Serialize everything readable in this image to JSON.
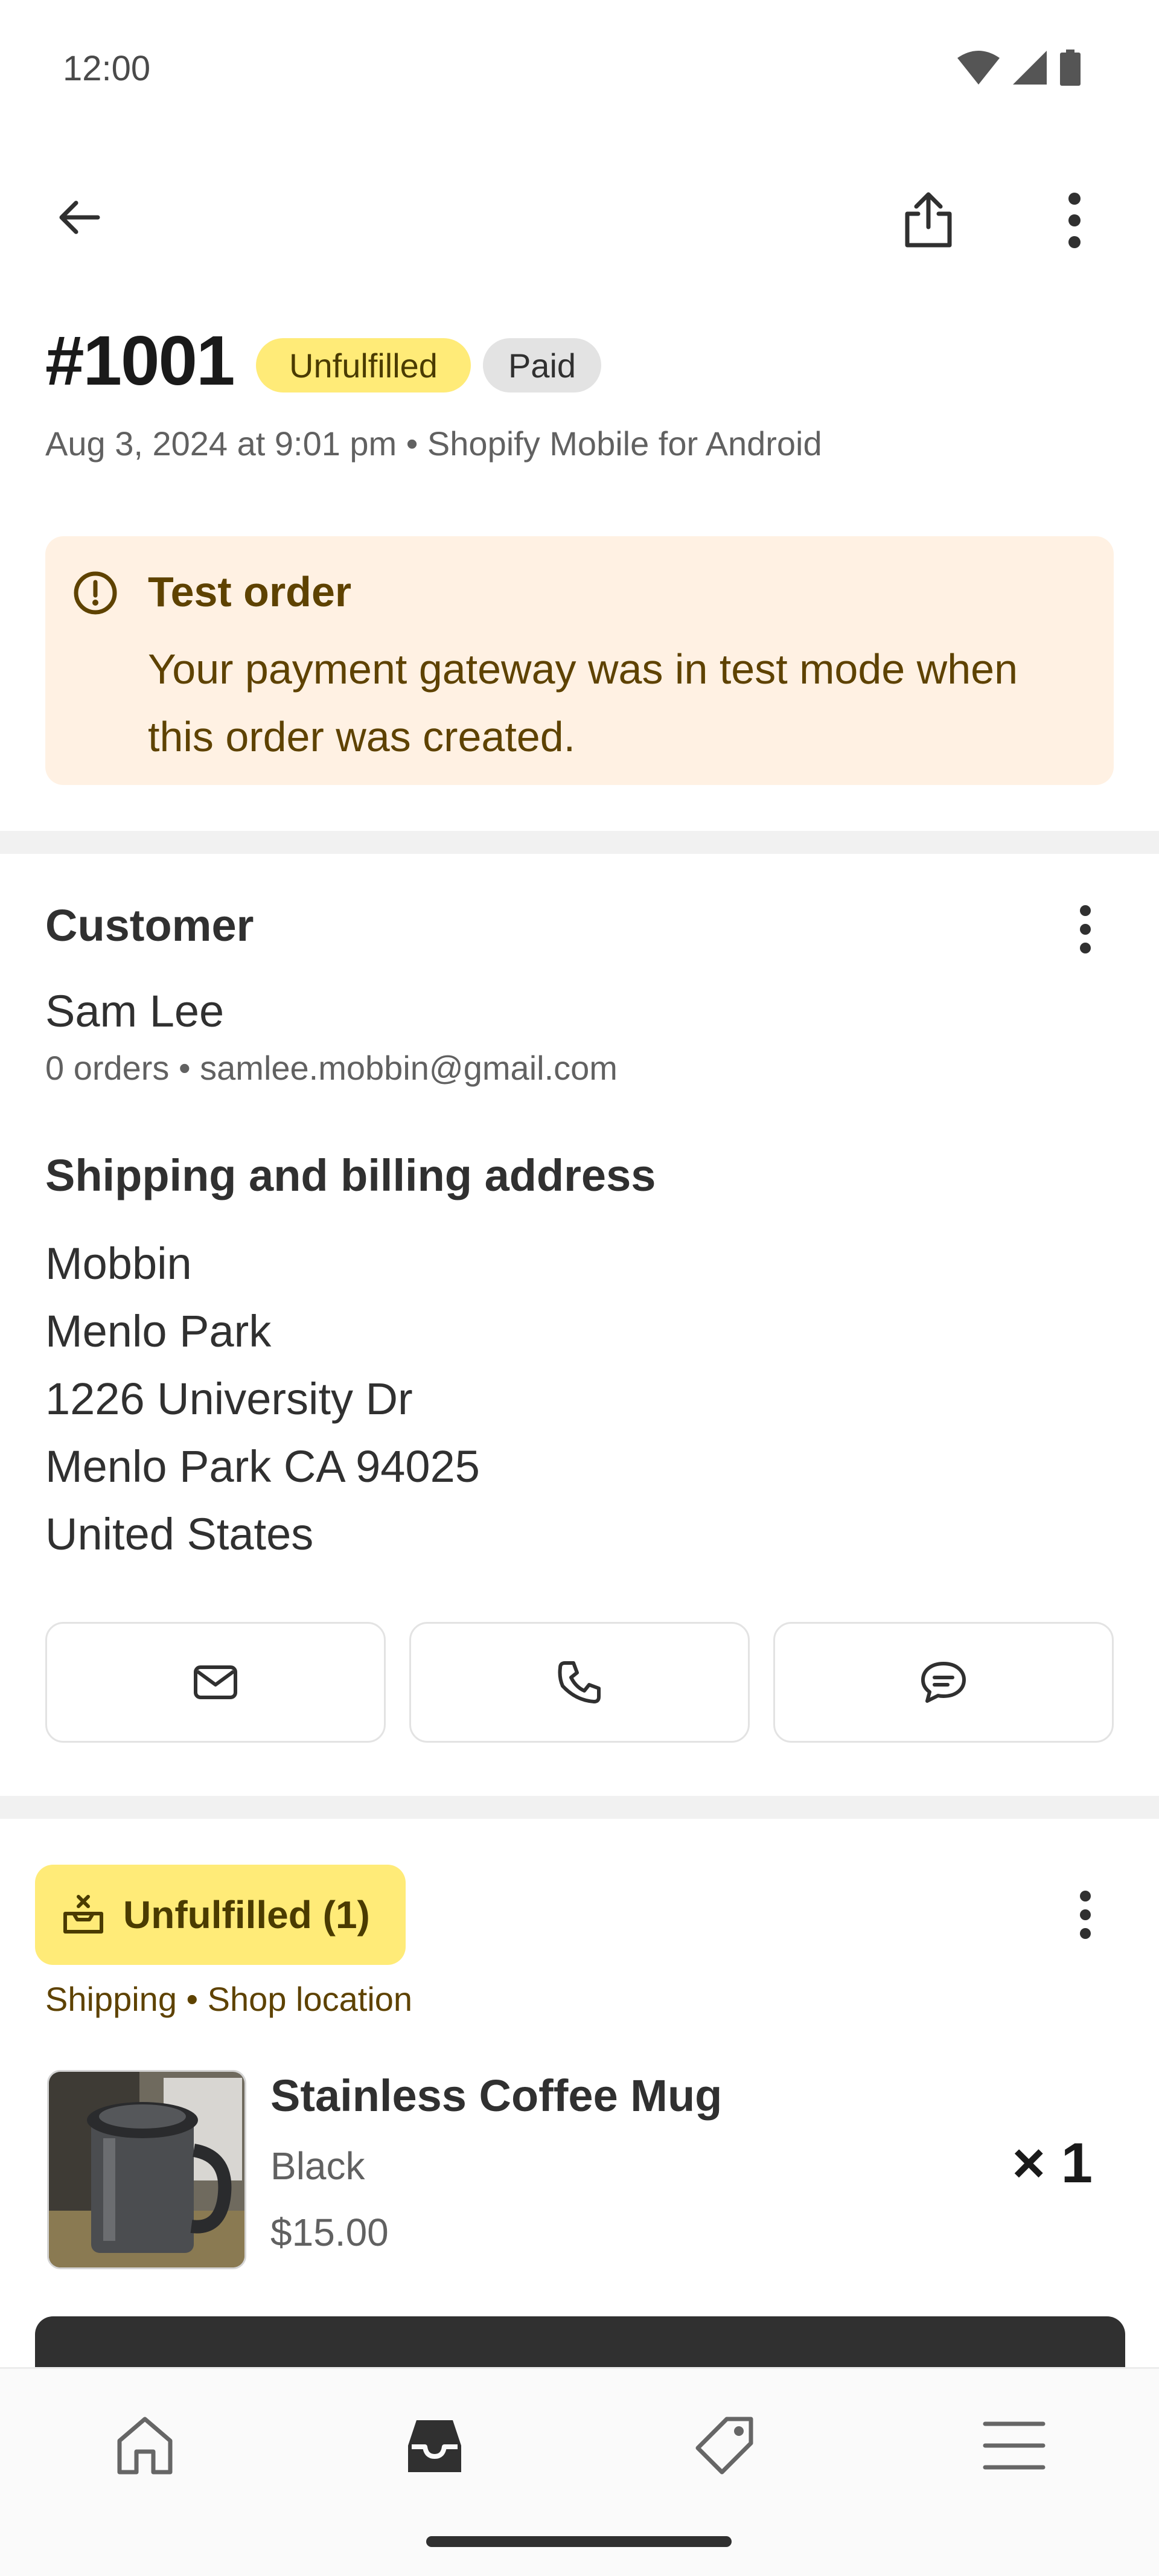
{
  "status_bar": {
    "time": "12:00"
  },
  "order": {
    "number": "#1001",
    "fulfillment_status": "Unfulfilled",
    "payment_status": "Paid",
    "meta": "Aug 3, 2024 at 9:01 pm • Shopify Mobile for Android"
  },
  "banner": {
    "title": "Test order",
    "body": "Your payment gateway was in test mode when this order was created."
  },
  "customer": {
    "section_title": "Customer",
    "name": "Sam Lee",
    "meta": "0 orders • samlee.mobbin@gmail.com"
  },
  "address": {
    "section_title": "Shipping and billing address",
    "lines": [
      "Mobbin",
      "Menlo Park",
      "1226 University Dr",
      "Menlo Park CA 94025",
      "United States"
    ]
  },
  "fulfillment": {
    "label": "Unfulfilled (1)",
    "meta": "Shipping • Shop location"
  },
  "product": {
    "name": "Stainless Coffee Mug",
    "variant": "Black",
    "price": "$15.00",
    "quantity": "× 1"
  },
  "colors": {
    "unfulfilled": "#ffeb78",
    "banner_bg": "#fff1e3",
    "banner_text": "#5e4200",
    "primary_button": "#303030"
  },
  "icons": {
    "back": "arrow-left-icon",
    "share": "share-icon",
    "more": "more-vertical-icon",
    "alert": "alert-circle-icon",
    "email": "mail-icon",
    "phone": "phone-icon",
    "message": "chat-icon",
    "fulfillment": "package-icon",
    "nav_home": "home-icon",
    "nav_orders": "inbox-icon",
    "nav_products": "tag-icon",
    "nav_menu": "menu-icon"
  }
}
